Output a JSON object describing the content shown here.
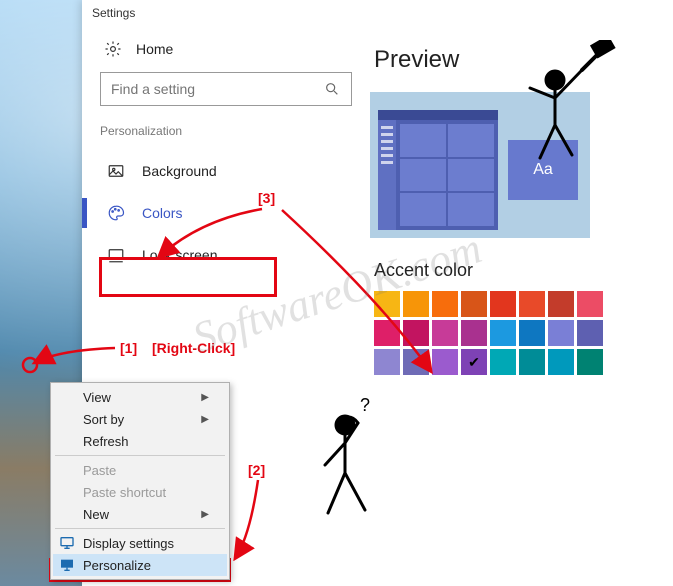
{
  "window": {
    "title": "Settings"
  },
  "sidebar": {
    "home": "Home",
    "search_placeholder": "Find a setting",
    "section": "Personalization",
    "items": [
      {
        "label": "Background"
      },
      {
        "label": "Colors"
      },
      {
        "label": "Lock screen"
      }
    ]
  },
  "preview": {
    "title": "Preview",
    "sample_text": "Aa",
    "accent_title": "Accent color"
  },
  "swatches": {
    "row1": [
      "#F7B614",
      "#F79508",
      "#F76D0C",
      "#D85518",
      "#E2361E",
      "#E84A29",
      "#C33C2B",
      "#EC4C65"
    ],
    "row2": [
      "#DE1F68",
      "#C21460",
      "#C73B98",
      "#A9318F",
      "#1C99E0",
      "#0E77C1",
      "#7A7FD6",
      "#5E60B1"
    ],
    "row3": [
      "#8E86D1",
      "#6F6BB6",
      "#9B5BCE",
      "#7E42B5",
      "#00A8B5",
      "#008C97",
      "#0099BC",
      "#008272"
    ],
    "selected": "#7E42B5"
  },
  "context_menu": {
    "items": [
      {
        "label": "View",
        "sub": true
      },
      {
        "label": "Sort by",
        "sub": true
      },
      {
        "label": "Refresh"
      },
      {
        "sep": true
      },
      {
        "label": "Paste",
        "disabled": true
      },
      {
        "label": "Paste shortcut",
        "disabled": true
      },
      {
        "label": "New",
        "sub": true
      },
      {
        "sep": true
      },
      {
        "label": "Display settings",
        "icon": "monitor"
      },
      {
        "label": "Personalize",
        "icon": "personalize",
        "highlight": true
      }
    ]
  },
  "annotations": {
    "n1": "[1]",
    "rc": "[Right-Click]",
    "n2": "[2]",
    "n3": "[3]"
  },
  "watermark": "SoftwareOK.com"
}
